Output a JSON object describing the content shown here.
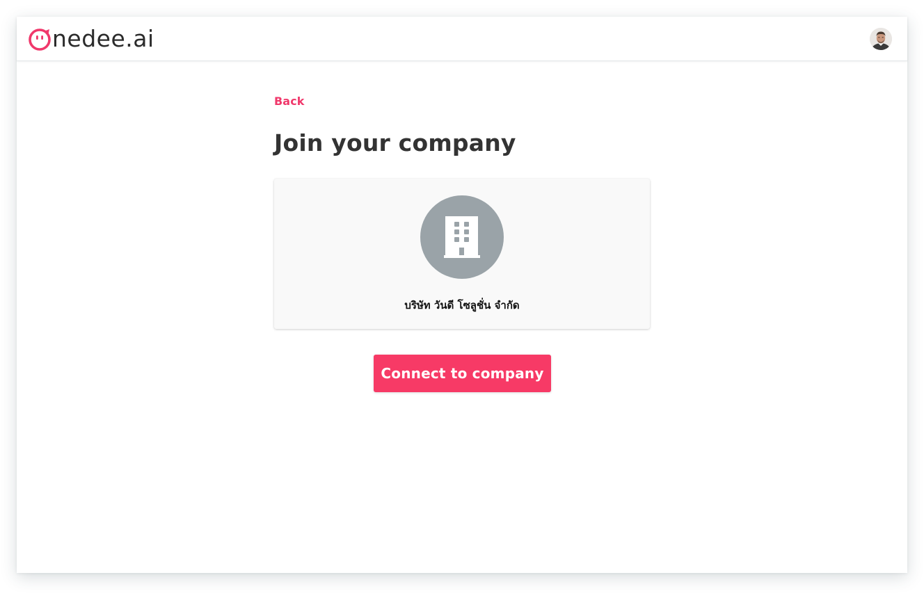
{
  "app": {
    "logo_text": "nedee.ai",
    "logo_icon": "onedee-face-logo-icon",
    "brand_color": "#f0386b"
  },
  "header": {
    "avatar_icon": "user-avatar-icon"
  },
  "page": {
    "back_label": "Back",
    "title": "Join your company"
  },
  "company": {
    "icon": "building-icon",
    "name": "บริษัท วันดี โซลูชั่น จำกัด",
    "icon_bg_color": "#9aa3a8"
  },
  "actions": {
    "connect_label": "Connect to company",
    "button_color": "#f73a66"
  }
}
